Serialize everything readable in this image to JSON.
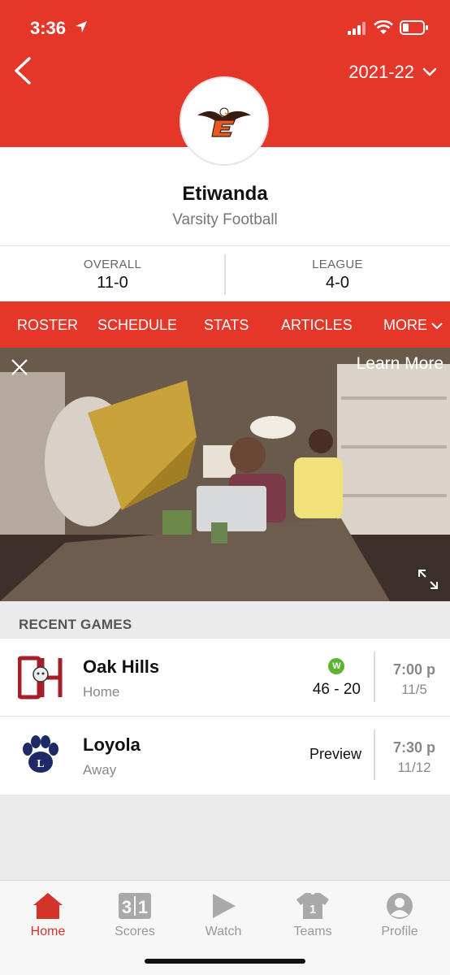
{
  "status_bar": {
    "time": "3:36"
  },
  "header": {
    "season": "2021-22"
  },
  "team": {
    "name": "Etiwanda",
    "sport": "Varsity Football"
  },
  "record": {
    "overall_label": "OVERALL",
    "overall_value": "11-0",
    "league_label": "LEAGUE",
    "league_value": "4-0"
  },
  "tabs": [
    "ROSTER",
    "SCHEDULE",
    "STATS",
    "ARTICLES",
    "MORE"
  ],
  "ad": {
    "learn_more": "Learn More"
  },
  "recent": {
    "heading": "RECENT GAMES",
    "games": [
      {
        "opponent": "Oak Hills",
        "location": "Home",
        "badge": "W",
        "score": "46 - 20",
        "time": "7:00 p",
        "date": "11/5"
      },
      {
        "opponent": "Loyola",
        "location": "Away",
        "status": "Preview",
        "time": "7:30 p",
        "date": "11/12"
      }
    ]
  },
  "nav": [
    {
      "label": "Home",
      "icon": "home-icon"
    },
    {
      "label": "Scores",
      "icon": "scoreboard-icon"
    },
    {
      "label": "Watch",
      "icon": "play-icon"
    },
    {
      "label": "Teams",
      "icon": "jersey-icon"
    },
    {
      "label": "Profile",
      "icon": "profile-icon"
    }
  ],
  "colors": {
    "brand_red": "#e5362a",
    "win_green": "#5cb531"
  }
}
